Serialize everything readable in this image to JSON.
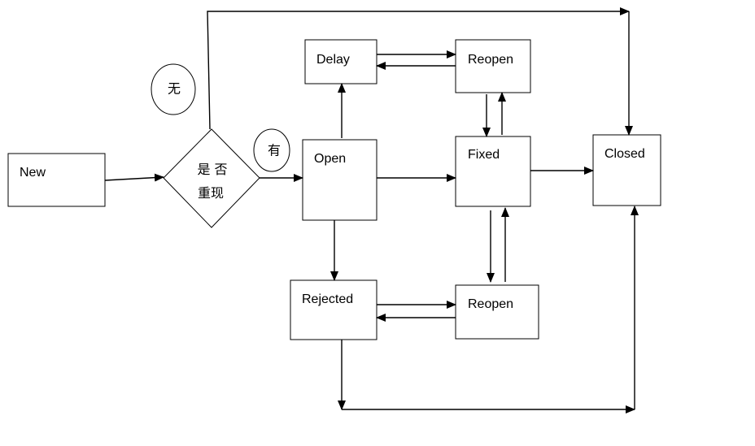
{
  "diagram": {
    "nodes": {
      "new": "New",
      "decision_line1": "是 否",
      "decision_line2": "重现",
      "open": "Open",
      "delay": "Delay",
      "reopen_top": "Reopen",
      "fixed": "Fixed",
      "closed": "Closed",
      "rejected": "Rejected",
      "reopen_bottom": "Reopen"
    },
    "edge_labels": {
      "no": "无",
      "yes": "有"
    },
    "colors": {
      "stroke": "#000000",
      "fill": "#ffffff"
    }
  }
}
